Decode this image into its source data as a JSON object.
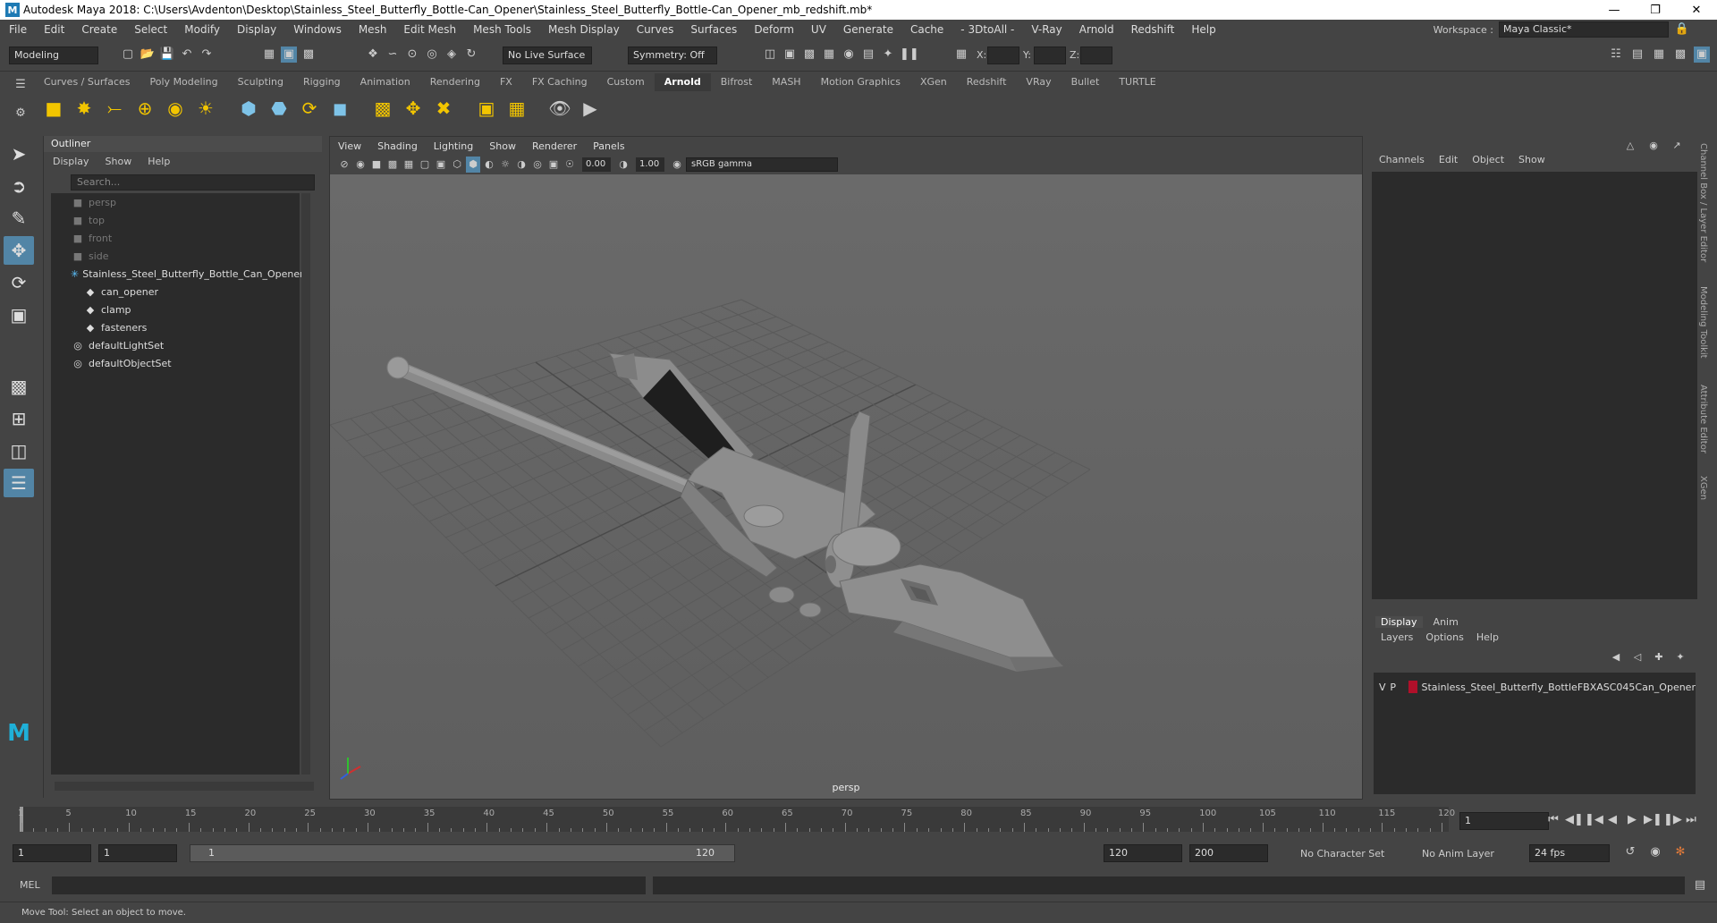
{
  "title": "Autodesk Maya 2018: C:\\Users\\Avdenton\\Desktop\\Stainless_Steel_Butterfly_Bottle-Can_Opener\\Stainless_Steel_Butterfly_Bottle-Can_Opener_mb_redshift.mb*",
  "menus": [
    "File",
    "Edit",
    "Create",
    "Select",
    "Modify",
    "Display",
    "Windows",
    "Mesh",
    "Edit Mesh",
    "Mesh Tools",
    "Mesh Display",
    "Curves",
    "Surfaces",
    "Deform",
    "UV",
    "Generate",
    "Cache",
    "- 3DtoAll -",
    "V-Ray",
    "Arnold",
    "Redshift",
    "Help"
  ],
  "workspace": {
    "label": "Workspace :",
    "value": "Maya Classic*"
  },
  "status": {
    "mode": "Modeling",
    "live_surface": "No Live Surface",
    "symmetry": "Symmetry: Off",
    "x": "X:",
    "y": "Y:",
    "z": "Z:"
  },
  "shelf_tabs": [
    "Curves / Surfaces",
    "Poly Modeling",
    "Sculpting",
    "Rigging",
    "Animation",
    "Rendering",
    "FX",
    "FX Caching",
    "Custom",
    "Arnold",
    "Bifrost",
    "MASH",
    "Motion Graphics",
    "XGen",
    "Redshift",
    "VRay",
    "Bullet",
    "TURTLE"
  ],
  "active_shelf": "Arnold",
  "outliner": {
    "title": "Outliner",
    "menu": [
      "Display",
      "Show",
      "Help"
    ],
    "search_placeholder": "Search...",
    "items": [
      {
        "label": "persp",
        "indent": 0,
        "icon": "camera-icon",
        "dim": true
      },
      {
        "label": "top",
        "indent": 0,
        "icon": "camera-icon",
        "dim": true
      },
      {
        "label": "front",
        "indent": 0,
        "icon": "camera-icon",
        "dim": true
      },
      {
        "label": "side",
        "indent": 0,
        "icon": "camera-icon",
        "dim": true
      },
      {
        "label": "Stainless_Steel_Butterfly_Bottle_Can_Opener",
        "indent": 0,
        "icon": "group-icon",
        "dim": false
      },
      {
        "label": "can_opener",
        "indent": 1,
        "icon": "mesh-icon",
        "dim": false
      },
      {
        "label": "clamp",
        "indent": 1,
        "icon": "mesh-icon",
        "dim": false
      },
      {
        "label": "fasteners",
        "indent": 1,
        "icon": "mesh-icon",
        "dim": false
      },
      {
        "label": "defaultLightSet",
        "indent": 0,
        "icon": "set-icon",
        "dim": false
      },
      {
        "label": "defaultObjectSet",
        "indent": 0,
        "icon": "set-icon",
        "dim": false
      }
    ]
  },
  "viewport": {
    "menu": [
      "View",
      "Shading",
      "Lighting",
      "Show",
      "Renderer",
      "Panels"
    ],
    "value1": "0.00",
    "value2": "1.00",
    "color_space": "sRGB gamma",
    "camera_label": "persp"
  },
  "channel_box": {
    "tabs": [
      "Channels",
      "Edit",
      "Object",
      "Show"
    ]
  },
  "layer_editor": {
    "tabs": [
      "Display",
      "Anim"
    ],
    "menu": [
      "Layers",
      "Options",
      "Help"
    ],
    "layer": {
      "v": "V",
      "p": "P",
      "name": "Stainless_Steel_Butterfly_BottleFBXASC045Can_Opener",
      "color": "#b0102a"
    }
  },
  "side_tabs": [
    "Channel Box / Layer Editor",
    "Modeling Toolkit",
    "Attribute Editor",
    "XGen"
  ],
  "timeline": {
    "ticks": [
      "1",
      "5",
      "10",
      "15",
      "20",
      "25",
      "30",
      "35",
      "40",
      "45",
      "50",
      "55",
      "60",
      "65",
      "70",
      "75",
      "80",
      "85",
      "90",
      "95",
      "100",
      "105",
      "110",
      "115",
      "120"
    ],
    "current_frame": "1"
  },
  "range": {
    "start": "1",
    "start2": "1",
    "range_start": "1",
    "range_end": "120",
    "end": "120",
    "end2": "200",
    "character_set": "No Character Set",
    "anim_layer": "No Anim Layer",
    "fps": "24 fps"
  },
  "command": {
    "label": "MEL"
  },
  "help_line": "Move Tool: Select an object to move."
}
